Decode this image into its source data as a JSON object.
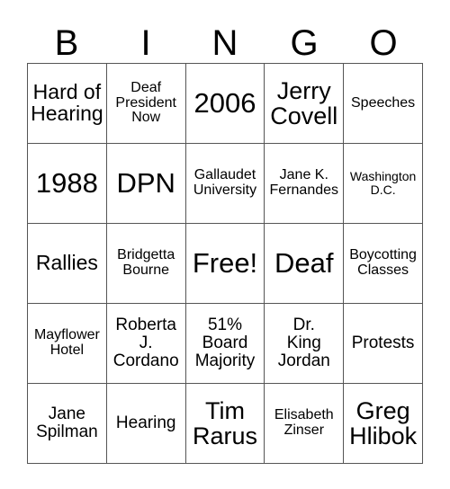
{
  "header": {
    "letters": [
      "B",
      "I",
      "N",
      "G",
      "O"
    ]
  },
  "grid": {
    "rows": [
      [
        {
          "text": "Hard of\nHearing",
          "size": "fs-l"
        },
        {
          "text": "Deaf\nPresident\nNow",
          "size": "fs-s"
        },
        {
          "text": "2006",
          "size": "fs-xxl"
        },
        {
          "text": "Jerry\nCovell",
          "size": "fs-xl"
        },
        {
          "text": "Speeches",
          "size": "fs-s"
        }
      ],
      [
        {
          "text": "1988",
          "size": "fs-xxl"
        },
        {
          "text": "DPN",
          "size": "fs-xxl"
        },
        {
          "text": "Gallaudet\nUniversity",
          "size": "fs-s"
        },
        {
          "text": "Jane K.\nFernandes",
          "size": "fs-s"
        },
        {
          "text": "Washington\nD.C.",
          "size": "fs-xs"
        }
      ],
      [
        {
          "text": "Rallies",
          "size": "fs-l"
        },
        {
          "text": "Bridgetta\nBourne",
          "size": "fs-s"
        },
        {
          "text": "Free!",
          "size": "fs-xxl"
        },
        {
          "text": "Deaf",
          "size": "fs-xxl"
        },
        {
          "text": "Boycotting\nClasses",
          "size": "fs-s"
        }
      ],
      [
        {
          "text": "Mayflower\nHotel",
          "size": "fs-s"
        },
        {
          "text": "Roberta\nJ.\nCordano",
          "size": "fs-m"
        },
        {
          "text": "51%\nBoard\nMajority",
          "size": "fs-m"
        },
        {
          "text": "Dr.\nKing\nJordan",
          "size": "fs-m"
        },
        {
          "text": "Protests",
          "size": "fs-m"
        }
      ],
      [
        {
          "text": "Jane\nSpilman",
          "size": "fs-m"
        },
        {
          "text": "Hearing",
          "size": "fs-m"
        },
        {
          "text": "Tim\nRarus",
          "size": "fs-xl"
        },
        {
          "text": "Elisabeth\nZinser",
          "size": "fs-s"
        },
        {
          "text": "Greg\nHlibok",
          "size": "fs-xl"
        }
      ]
    ]
  },
  "colors": {
    "background": "#ffffff",
    "text": "#000000",
    "grid_line": "#555555"
  }
}
